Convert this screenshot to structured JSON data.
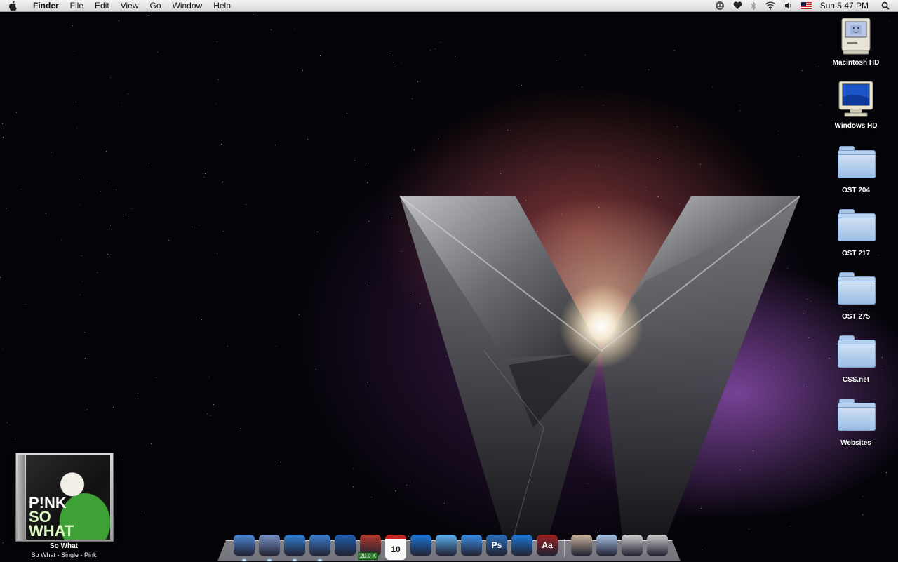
{
  "menubar": {
    "app_name": "Finder",
    "menus": [
      "File",
      "Edit",
      "View",
      "Go",
      "Window",
      "Help"
    ],
    "clock": "Sun 5:47 PM",
    "status_icons": [
      "skype-icon",
      "heart-icon",
      "bluetooth-icon",
      "wifi-icon",
      "volume-icon",
      "us-flag-input-icon",
      "spotlight-icon"
    ]
  },
  "desktop_icons": [
    {
      "label": "Macintosh HD",
      "icon": "classic-mac-icon"
    },
    {
      "label": "Windows HD",
      "icon": "windows-drive-icon"
    },
    {
      "label": "OST 204",
      "icon": "folder-icon"
    },
    {
      "label": "OST 217",
      "icon": "folder-icon"
    },
    {
      "label": "OST 275",
      "icon": "folder-icon"
    },
    {
      "label": "CSS.net",
      "icon": "folder-icon"
    },
    {
      "label": "Websites",
      "icon": "folder-icon"
    }
  ],
  "album": {
    "cover_line1": "P!NK",
    "cover_line2": "SO",
    "cover_line3": "WHAT",
    "title": "So What",
    "subtitle": "So What - Single - Pink"
  },
  "dock": {
    "apps": [
      {
        "icon": "finder-icon",
        "color": "#4a86d6"
      },
      {
        "icon": "mail-icon",
        "color": "#7a95c8"
      },
      {
        "icon": "adium-icon",
        "color": "#2f7fd2"
      },
      {
        "icon": "safari-icon",
        "color": "#3b7ed0"
      },
      {
        "icon": "myspace-icon",
        "color": "#1f5fb0"
      },
      {
        "icon": "transmission-icon",
        "color": "#b33a2b",
        "badge": "20.0 K"
      },
      {
        "icon": "ical-icon",
        "color": "#f0f0f0",
        "text": "10"
      },
      {
        "icon": "quicktime-icon",
        "color": "#1873d6"
      },
      {
        "icon": "itunes-icon",
        "color": "#5ab0ef"
      },
      {
        "icon": "ichat-icon",
        "color": "#3a8ee6"
      },
      {
        "icon": "photoshop-icon",
        "color": "#2b6fb8",
        "text": "Ps"
      },
      {
        "icon": "wave-icon",
        "color": "#1a77d4"
      },
      {
        "icon": "dictionary-icon",
        "color": "#9b2323",
        "text": "Aa"
      }
    ],
    "stacks": [
      {
        "icon": "applications-stack-icon",
        "color": "#c9b39a"
      },
      {
        "icon": "documents-stack-icon",
        "color": "#a9c4e6"
      },
      {
        "icon": "downloads-stack-icon",
        "color": "#d1d1d1"
      },
      {
        "icon": "trash-icon",
        "color": "#cfcfcf"
      }
    ]
  }
}
